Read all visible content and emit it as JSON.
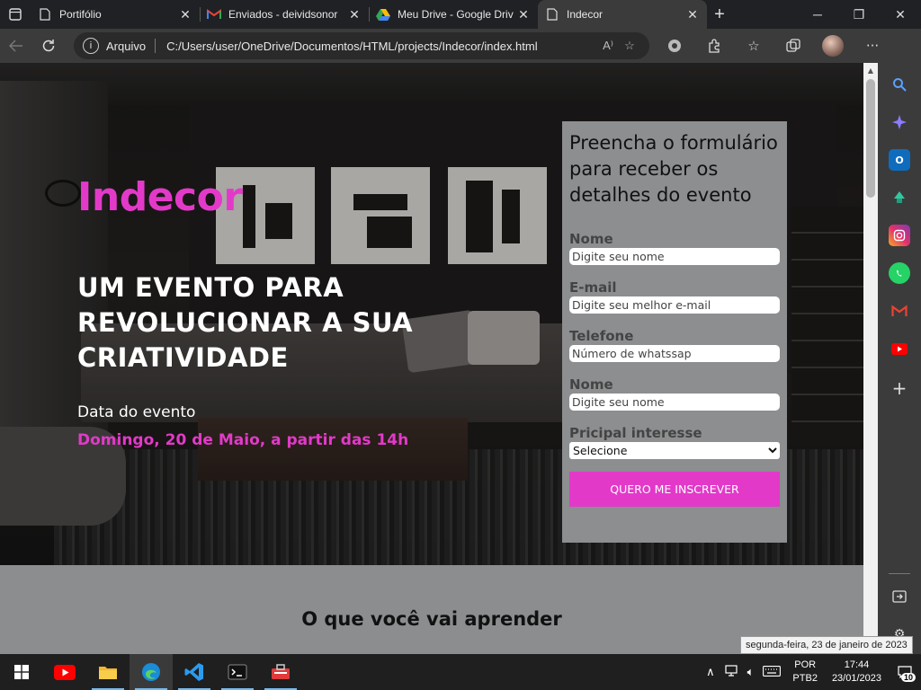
{
  "browser": {
    "tabs": [
      {
        "title": "Portifólio",
        "icon": "page-icon",
        "active": false
      },
      {
        "title": "Enviados - deividsonor",
        "icon": "gmail-icon",
        "active": false
      },
      {
        "title": "Meu Drive - Google Driv",
        "icon": "google-drive-icon",
        "active": false
      },
      {
        "title": "Indecor",
        "icon": "page-icon",
        "active": true
      }
    ],
    "address": {
      "scheme_label": "Arquivo",
      "url": "C:/Users/user/OneDrive/Documentos/HTML/projects/Indecor/index.html"
    }
  },
  "page": {
    "brand": "Indecor",
    "headline": "UM EVENTO PARA REVOLUCIONAR A SUA CRIATIVIDADE",
    "date_label": "Data do evento",
    "date_value": "Domingo, 20 de Maio, a partir das 14h",
    "form": {
      "title": "Preencha o formulário para receber os detalhes do evento",
      "fields": [
        {
          "label": "Nome",
          "placeholder": "Digite seu nome"
        },
        {
          "label": "E-mail",
          "placeholder": "Digite seu melhor e-mail"
        },
        {
          "label": "Telefone",
          "placeholder": "Número de whatssap"
        },
        {
          "label": "Nome",
          "placeholder": "Digite seu nome"
        }
      ],
      "select_label": "Pricipal interesse",
      "select_value": "Selecione",
      "submit_label": "QUERO ME INSCREVER"
    },
    "section_title": "O que você vai aprender",
    "accent_color": "#e339c9"
  },
  "taskbar": {
    "lang": {
      "line1": "POR",
      "line2": "PTB2"
    },
    "time": "17:44",
    "date": "23/01/2023",
    "notifications": "10",
    "tooltip": "segunda-feira, 23 de janeiro de 2023"
  }
}
